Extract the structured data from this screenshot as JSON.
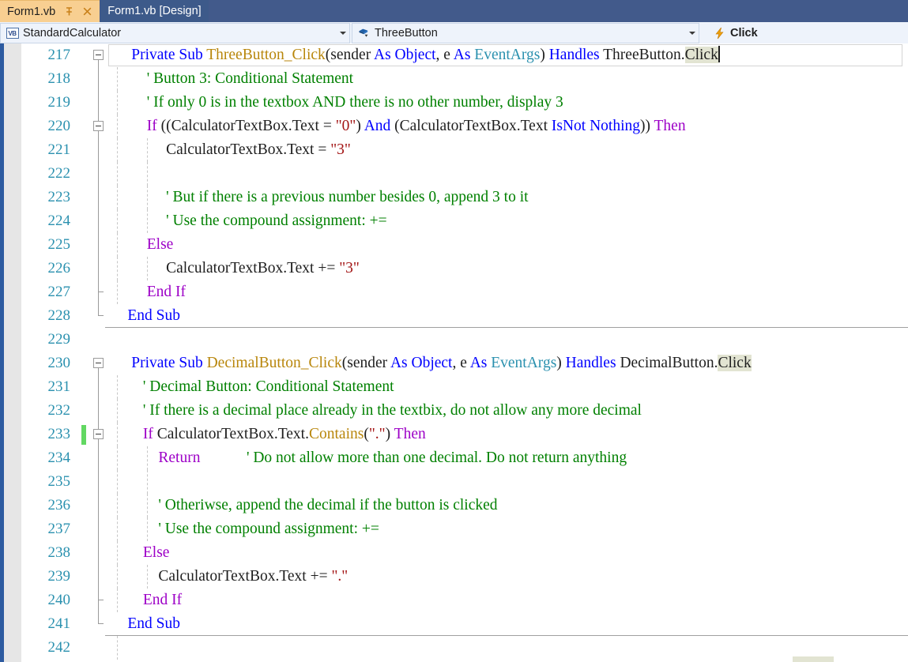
{
  "window": {
    "tabs": [
      {
        "label": "Form1.vb",
        "active": true,
        "pin_icon": "pin-icon",
        "close_icon": "close-icon"
      },
      {
        "label": "Form1.vb [Design]",
        "active": false
      }
    ]
  },
  "navbar": {
    "project_icon": "vb-project-icon",
    "project_label": "StandardCalculator",
    "member_icon": "method-object-icon",
    "member_label": "ThreeButton",
    "event_icon": "event-lightning-icon",
    "event_label": "Click",
    "dropdown_icon": "chevron-down-icon"
  },
  "editor": {
    "first_line_number": 217,
    "colors": {
      "keyword": "#0000ff",
      "control_flow": "#9d00c7",
      "comment": "#008000",
      "string": "#a31515",
      "type": "#2b91af",
      "method": "#b8860b",
      "identifier": "#1e1e1e",
      "reference_highlight": "#e2e4d2",
      "change_bar_saved": "#62d862",
      "line_number": "#2b91af"
    },
    "lines": [
      {
        "num": "217",
        "outline": "collapse",
        "vline": "half-bottom",
        "current": true,
        "changebar": false,
        "indents": [],
        "tokens": [
          {
            "t": "      ",
            "c": "idn"
          },
          {
            "t": "Private Sub ",
            "c": "kw"
          },
          {
            "t": "ThreeButton_Click",
            "c": "mth"
          },
          {
            "t": "(",
            "c": "idn"
          },
          {
            "t": "sender ",
            "c": "idn"
          },
          {
            "t": "As ",
            "c": "kw"
          },
          {
            "t": "Object",
            "c": "kw"
          },
          {
            "t": ", e ",
            "c": "idn"
          },
          {
            "t": "As ",
            "c": "kw"
          },
          {
            "t": "EventArgs",
            "c": "typ"
          },
          {
            "t": ") ",
            "c": "idn"
          },
          {
            "t": "Handles ",
            "c": "kw"
          },
          {
            "t": "ThreeButton.",
            "c": "idn"
          },
          {
            "t": "Click",
            "c": "idn",
            "hl": true
          },
          {
            "t": "|CARET|",
            "c": "caret"
          }
        ]
      },
      {
        "num": "218",
        "outline": "line",
        "vline": "full",
        "changebar": false,
        "indents": [
          0
        ],
        "tokens": [
          {
            "t": "          ' Button 3: Conditional Statement",
            "c": "cmt"
          }
        ]
      },
      {
        "num": "219",
        "outline": "line",
        "vline": "full",
        "changebar": false,
        "indents": [
          0
        ],
        "tokens": [
          {
            "t": "          ' If only 0 is in the textbox AND there is no other number, display 3",
            "c": "cmt"
          }
        ]
      },
      {
        "num": "220",
        "outline": "collapse",
        "vline": "full",
        "changebar": false,
        "indents": [
          0
        ],
        "tokens": [
          {
            "t": "          ",
            "c": "idn"
          },
          {
            "t": "If ",
            "c": "cf"
          },
          {
            "t": "((CalculatorTextBox.Text = ",
            "c": "idn"
          },
          {
            "t": "\"0\"",
            "c": "str"
          },
          {
            "t": ") ",
            "c": "idn"
          },
          {
            "t": "And ",
            "c": "kw"
          },
          {
            "t": "(CalculatorTextBox.Text ",
            "c": "idn"
          },
          {
            "t": "IsNot Nothing",
            "c": "kw"
          },
          {
            "t": ")) ",
            "c": "idn"
          },
          {
            "t": "Then",
            "c": "cf"
          }
        ]
      },
      {
        "num": "221",
        "outline": "line",
        "vline": "full",
        "changebar": false,
        "indents": [
          0,
          1
        ],
        "tokens": [
          {
            "t": "               CalculatorTextBox.Text = ",
            "c": "idn"
          },
          {
            "t": "\"3\"",
            "c": "str"
          }
        ]
      },
      {
        "num": "222",
        "outline": "line",
        "vline": "full",
        "changebar": false,
        "indents": [
          0,
          1
        ],
        "tokens": []
      },
      {
        "num": "223",
        "outline": "line",
        "vline": "full",
        "changebar": false,
        "indents": [
          0,
          1
        ],
        "tokens": [
          {
            "t": "               ' But if there is a previous number besides 0, append 3 to it",
            "c": "cmt"
          }
        ]
      },
      {
        "num": "224",
        "outline": "line",
        "vline": "full",
        "changebar": false,
        "indents": [
          0,
          1
        ],
        "tokens": [
          {
            "t": "               ' Use the compound assignment: +=",
            "c": "cmt"
          }
        ]
      },
      {
        "num": "225",
        "outline": "line",
        "vline": "full",
        "changebar": false,
        "indents": [
          0
        ],
        "tokens": [
          {
            "t": "          ",
            "c": "idn"
          },
          {
            "t": "Else",
            "c": "cf"
          }
        ]
      },
      {
        "num": "226",
        "outline": "line",
        "vline": "full",
        "changebar": false,
        "indents": [
          0,
          1
        ],
        "tokens": [
          {
            "t": "               CalculatorTextBox.Text += ",
            "c": "idn"
          },
          {
            "t": "\"3\"",
            "c": "str"
          }
        ]
      },
      {
        "num": "227",
        "outline": "elbow",
        "vline": "full",
        "changebar": false,
        "indents": [
          0
        ],
        "tokens": [
          {
            "t": "          ",
            "c": "idn"
          },
          {
            "t": "End If",
            "c": "cf"
          }
        ]
      },
      {
        "num": "228",
        "outline": "elbow-end",
        "vline": "half-top",
        "changebar": false,
        "separator": true,
        "indents": [],
        "tokens": [
          {
            "t": "     ",
            "c": "idn"
          },
          {
            "t": "End Sub",
            "c": "kw"
          }
        ]
      },
      {
        "num": "229",
        "outline": "none",
        "vline": "none",
        "changebar": false,
        "indents": [],
        "tokens": []
      },
      {
        "num": "230",
        "outline": "collapse",
        "vline": "half-bottom",
        "changebar": false,
        "indents": [],
        "tokens": [
          {
            "t": "      ",
            "c": "idn"
          },
          {
            "t": "Private Sub ",
            "c": "kw"
          },
          {
            "t": "DecimalButton_Click",
            "c": "mth"
          },
          {
            "t": "(",
            "c": "idn"
          },
          {
            "t": "sender ",
            "c": "idn"
          },
          {
            "t": "As ",
            "c": "kw"
          },
          {
            "t": "Object",
            "c": "kw"
          },
          {
            "t": ", e ",
            "c": "idn"
          },
          {
            "t": "As ",
            "c": "kw"
          },
          {
            "t": "EventArgs",
            "c": "typ"
          },
          {
            "t": ") ",
            "c": "idn"
          },
          {
            "t": "Handles ",
            "c": "kw"
          },
          {
            "t": "DecimalButton.",
            "c": "idn"
          },
          {
            "t": "Click",
            "c": "idn",
            "hl": true
          }
        ]
      },
      {
        "num": "231",
        "outline": "line",
        "vline": "full",
        "changebar": false,
        "indents": [
          0
        ],
        "tokens": [
          {
            "t": "         ' Decimal Button: Conditional Statement",
            "c": "cmt"
          }
        ]
      },
      {
        "num": "232",
        "outline": "line",
        "vline": "full",
        "changebar": false,
        "indents": [
          0
        ],
        "tokens": [
          {
            "t": "         ' If there is a decimal place already in the textbix, do not allow any more decimal",
            "c": "cmt"
          }
        ]
      },
      {
        "num": "233",
        "outline": "collapse",
        "vline": "full",
        "changebar": true,
        "indents": [
          0
        ],
        "tokens": [
          {
            "t": "         ",
            "c": "idn"
          },
          {
            "t": "If ",
            "c": "cf"
          },
          {
            "t": "CalculatorTextBox.Text.",
            "c": "idn"
          },
          {
            "t": "Contains",
            "c": "mth"
          },
          {
            "t": "(",
            "c": "idn"
          },
          {
            "t": "\".\"",
            "c": "str"
          },
          {
            "t": ") ",
            "c": "idn"
          },
          {
            "t": "Then",
            "c": "cf"
          }
        ]
      },
      {
        "num": "234",
        "outline": "line",
        "vline": "full",
        "changebar": false,
        "indents": [
          0,
          1
        ],
        "tokens": [
          {
            "t": "             ",
            "c": "idn"
          },
          {
            "t": "Return",
            "c": "cf"
          },
          {
            "t": "            ' Do not allow more than one decimal. Do not return anything",
            "c": "cmt"
          }
        ]
      },
      {
        "num": "235",
        "outline": "line",
        "vline": "full",
        "changebar": false,
        "indents": [
          0,
          1
        ],
        "tokens": []
      },
      {
        "num": "236",
        "outline": "line",
        "vline": "full",
        "changebar": false,
        "indents": [
          0,
          1
        ],
        "tokens": [
          {
            "t": "             ' Otheriwse, append the decimal if the button is clicked",
            "c": "cmt"
          }
        ]
      },
      {
        "num": "237",
        "outline": "line",
        "vline": "full",
        "changebar": false,
        "indents": [
          0,
          1
        ],
        "tokens": [
          {
            "t": "             ' Use the compound assignment: +=",
            "c": "cmt"
          }
        ]
      },
      {
        "num": "238",
        "outline": "line",
        "vline": "full",
        "changebar": false,
        "indents": [
          0
        ],
        "tokens": [
          {
            "t": "         ",
            "c": "idn"
          },
          {
            "t": "Else",
            "c": "cf"
          }
        ]
      },
      {
        "num": "239",
        "outline": "line",
        "vline": "full",
        "changebar": false,
        "indents": [
          0,
          1
        ],
        "tokens": [
          {
            "t": "             CalculatorTextBox.Text += ",
            "c": "idn"
          },
          {
            "t": "\".\"",
            "c": "str"
          }
        ]
      },
      {
        "num": "240",
        "outline": "elbow",
        "vline": "full",
        "changebar": false,
        "indents": [
          0
        ],
        "tokens": [
          {
            "t": "         ",
            "c": "idn"
          },
          {
            "t": "End If",
            "c": "cf"
          }
        ]
      },
      {
        "num": "241",
        "outline": "elbow-end",
        "vline": "half-top",
        "changebar": false,
        "separator": true,
        "indents": [],
        "tokens": [
          {
            "t": "     ",
            "c": "idn"
          },
          {
            "t": "End Sub",
            "c": "kw"
          }
        ]
      },
      {
        "num": "242",
        "outline": "none",
        "vline": "none",
        "changebar": false,
        "indents": [
          0
        ],
        "tokens": []
      }
    ]
  }
}
